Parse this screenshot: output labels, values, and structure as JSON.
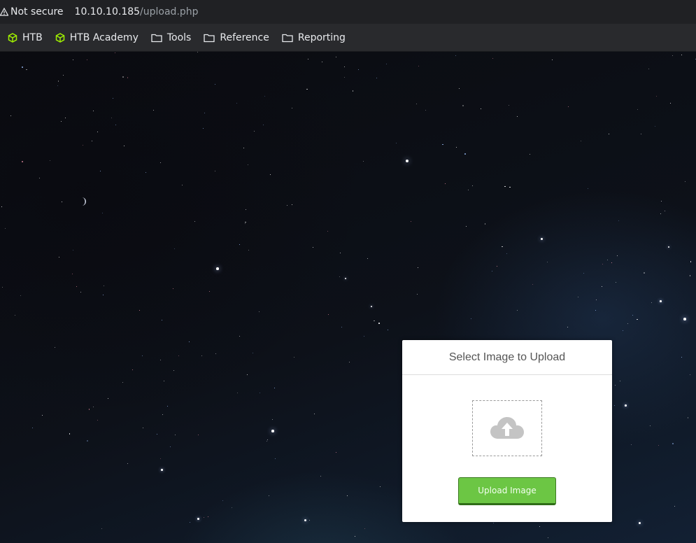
{
  "browser": {
    "security_label": "Not secure",
    "url_host": "10.10.10.185",
    "url_path": "/upload.php"
  },
  "bookmarks": [
    {
      "label": "HTB",
      "icon": "htb-cube-icon"
    },
    {
      "label": "HTB Academy",
      "icon": "htb-cube-icon"
    },
    {
      "label": "Tools",
      "icon": "folder-icon"
    },
    {
      "label": "Reference",
      "icon": "folder-icon"
    },
    {
      "label": "Reporting",
      "icon": "folder-icon"
    }
  ],
  "upload": {
    "title": "Select Image to Upload",
    "dropzone_icon": "cloud-upload-icon",
    "button_label": "Upload Image"
  },
  "colors": {
    "accent_green": "#6cc644",
    "htb_green": "#9fef00"
  }
}
